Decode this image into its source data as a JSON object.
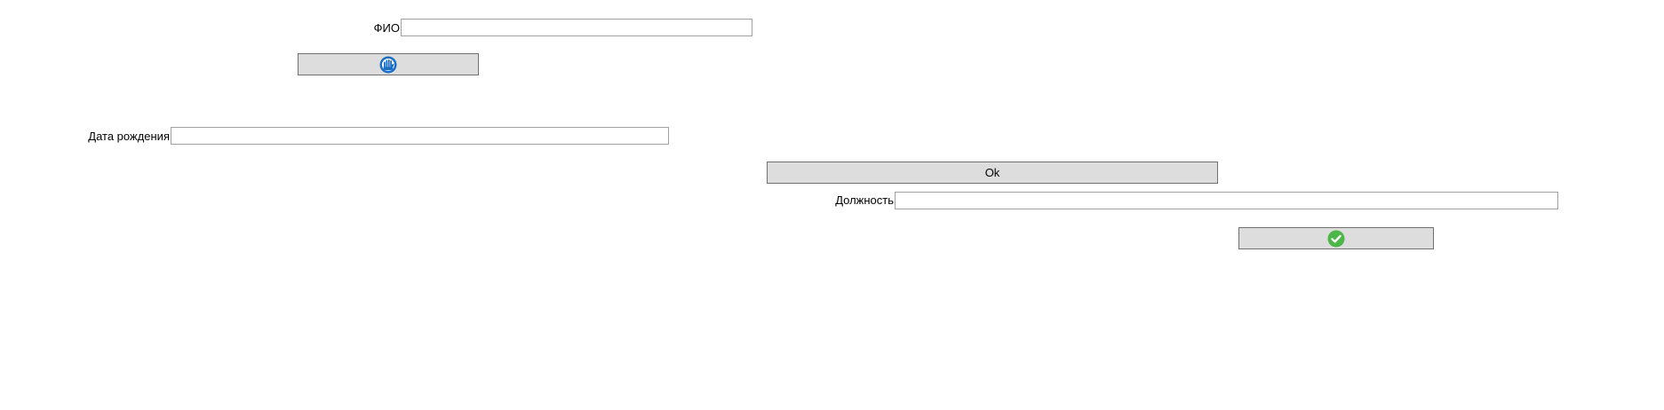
{
  "form": {
    "fio_label": "ФИО",
    "fio_value": "",
    "birth_date_label": "Дата рождения",
    "birth_date_value": "",
    "position_label": "Должность",
    "position_value": "",
    "ok_button_label": "Ok"
  },
  "icons": {
    "first_button_icon": "blue-hand-icon",
    "second_button_icon": "green-checkmark-icon"
  },
  "colors": {
    "button_background": "#dddddd",
    "button_border": "#707070",
    "field_border": "#a0a0a0",
    "hand_icon_blue": "#1a6fc4",
    "check_icon_green": "#4cb748"
  }
}
